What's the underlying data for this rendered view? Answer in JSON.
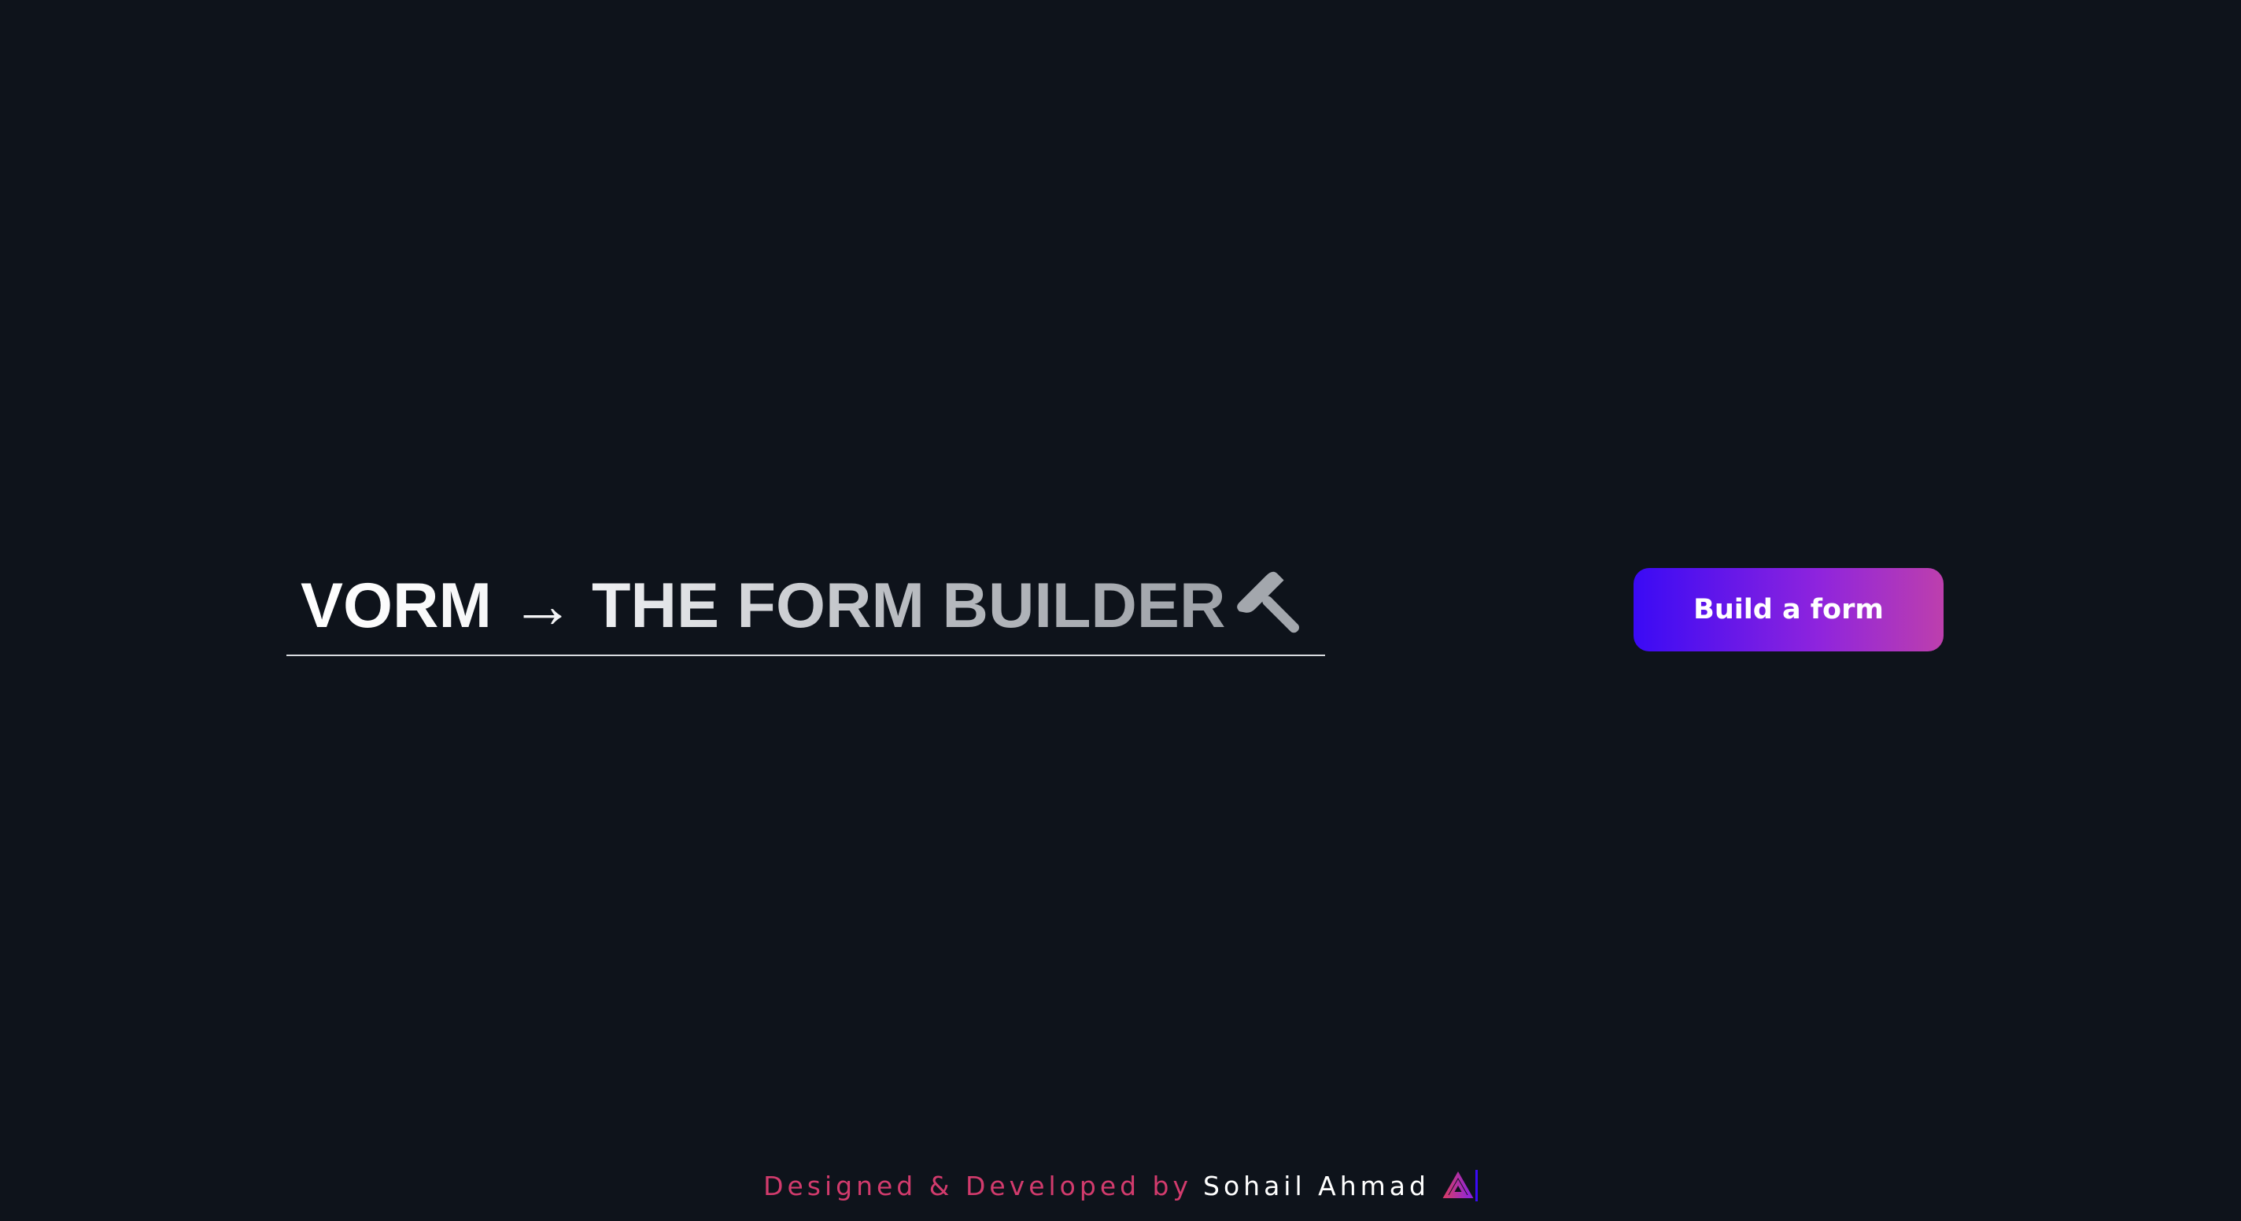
{
  "hero": {
    "brand": "VORM",
    "arrow": "→",
    "tagline": "THE FORM BUILDER",
    "icon": "hammer-icon"
  },
  "actions": {
    "build_label": "Build a form"
  },
  "footer": {
    "credit": "Designed & Developed by",
    "author": "Sohail Ahmad",
    "logo_icon": "author-logo-icon"
  },
  "colors": {
    "background": "#0e131b",
    "button_gradient_start": "#3a0af5",
    "button_gradient_end": "#bd3fad",
    "credit_text": "#d23b6d",
    "author_text": "#ffffff"
  }
}
